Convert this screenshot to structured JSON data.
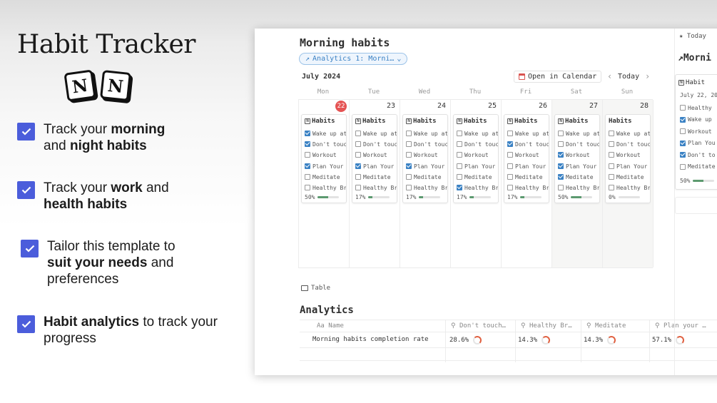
{
  "promo": {
    "title": "Habit Tracker",
    "logo_letter": "N",
    "features": [
      {
        "parts": [
          "Track your ",
          "morning",
          " and ",
          "night habits",
          ""
        ]
      },
      {
        "parts": [
          "Track your ",
          "work",
          " and ",
          "health habits",
          ""
        ]
      },
      {
        "parts": [
          "Tailor this template to ",
          "suit your needs",
          " and preferences",
          "",
          ""
        ]
      },
      {
        "parts": [
          "",
          "Habit analytics",
          " to track your progress",
          "",
          ""
        ]
      }
    ]
  },
  "app": {
    "title": "Morning habits",
    "view_chip": "Analytics 1: Morni…",
    "month": "July 2024",
    "open_calendar": "Open in Calendar",
    "today": "Today",
    "weekdays": [
      "Mon",
      "Tue",
      "Wed",
      "Thu",
      "Fri",
      "Sat",
      "Sun"
    ],
    "days": [
      {
        "num": "22",
        "is_today": true,
        "weekend": false,
        "card_title": "Habits",
        "icon": true,
        "checks": [
          true,
          true,
          false,
          true,
          false,
          false
        ],
        "progress": "50%",
        "fraction": 0.5
      },
      {
        "num": "23",
        "is_today": false,
        "weekend": false,
        "card_title": "Habits",
        "icon": true,
        "checks": [
          false,
          false,
          false,
          true,
          false,
          false
        ],
        "progress": "17%",
        "fraction": 0.17
      },
      {
        "num": "24",
        "is_today": false,
        "weekend": false,
        "card_title": "Habits",
        "icon": true,
        "checks": [
          false,
          false,
          false,
          true,
          false,
          false
        ],
        "progress": "17%",
        "fraction": 0.17
      },
      {
        "num": "25",
        "is_today": false,
        "weekend": false,
        "card_title": "Habits",
        "icon": true,
        "checks": [
          false,
          false,
          false,
          false,
          false,
          true
        ],
        "progress": "17%",
        "fraction": 0.17
      },
      {
        "num": "26",
        "is_today": false,
        "weekend": false,
        "card_title": "Habits",
        "icon": true,
        "checks": [
          false,
          true,
          false,
          false,
          false,
          false
        ],
        "progress": "17%",
        "fraction": 0.17
      },
      {
        "num": "27",
        "is_today": false,
        "weekend": true,
        "card_title": "Habits",
        "icon": true,
        "checks": [
          false,
          false,
          true,
          true,
          true,
          false
        ],
        "progress": "50%",
        "fraction": 0.5
      },
      {
        "num": "28",
        "is_today": false,
        "weekend": true,
        "card_title": "Habits",
        "icon": false,
        "checks": [
          false,
          false,
          false,
          false,
          false,
          false
        ],
        "progress": "0%",
        "fraction": 0
      }
    ],
    "tasks": [
      "Wake up at",
      "Don't touch",
      "Workout",
      "Plan Your",
      "Meditate",
      "Healthy Br"
    ],
    "table_tab": "Table",
    "analytics_title": "Analytics",
    "columns": [
      "Aa Name",
      "Don't touch…",
      "Healthy Br…",
      "Meditate",
      "Plan your …"
    ],
    "row": {
      "name": "Morning habits completion rate",
      "values": [
        "28.6%",
        "14.3%",
        "14.3%",
        "57.1%"
      ]
    }
  },
  "side": {
    "today_label": "Today",
    "title": "Morni",
    "card_title": "Habit",
    "date": "July 22, 20",
    "tasks": [
      "Healthy",
      "Wake up",
      "Workout",
      "Plan You",
      "Don't to",
      "Meditate"
    ],
    "checks": [
      false,
      true,
      false,
      true,
      true,
      false
    ],
    "progress": "50%",
    "fraction": 0.5
  },
  "colors": {
    "accent": "#4b5ddb",
    "link": "#3b82c4",
    "today": "#e55353",
    "progress": "#5c9a6f"
  }
}
